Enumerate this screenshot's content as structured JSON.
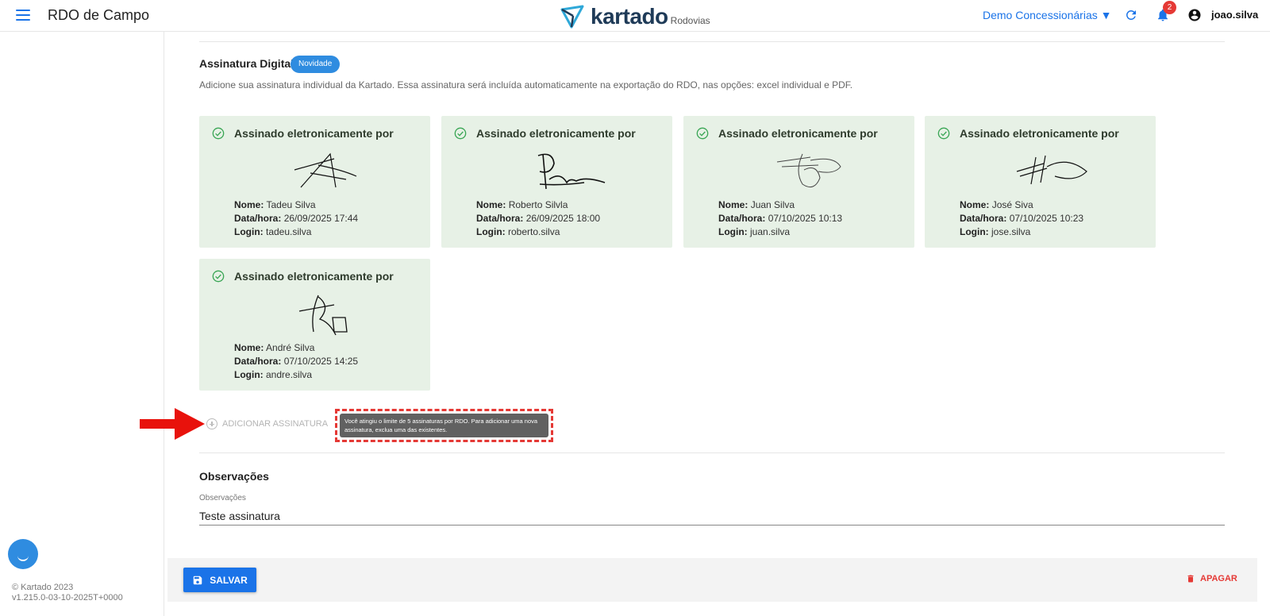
{
  "header": {
    "app_title": "RDO de Campo",
    "logo_word": "kartado",
    "logo_sub": "Rodovias",
    "org_select": "Demo Concessionárias ▼",
    "notification_count": "2",
    "user_name": "joao.silva"
  },
  "sidebar": {
    "copyright_line1": "© Kartado 2023",
    "copyright_line2": "v1.215.0-03-10-2025T+0000"
  },
  "signatures_section": {
    "title": "Assinatura Digital",
    "badge": "Novidade",
    "description": "Adicione sua assinatura individual da Kartado. Essa assinatura será incluída automaticamente na exportação do RDO, nas opções: excel individual e PDF.",
    "card_heading": "Assinado eletronicamente por",
    "label_name": "Nome:",
    "label_datetime": "Data/hora:",
    "label_login": "Login:",
    "cards": [
      {
        "name": "Tadeu Silva",
        "datetime": "26/09/2025 17:44",
        "login": "tadeu.silva"
      },
      {
        "name": "Roberto Silvla",
        "datetime": "26/09/2025 18:00",
        "login": "roberto.silva"
      },
      {
        "name": "Juan Silva",
        "datetime": "07/10/2025 10:13",
        "login": "juan.silva"
      },
      {
        "name": "José Siva",
        "datetime": "07/10/2025 10:23",
        "login": "jose.silva"
      },
      {
        "name": "André Silva",
        "datetime": "07/10/2025 14:25",
        "login": "andre.silva"
      }
    ],
    "add_button": "ADICIONAR ASSINATURA",
    "tooltip": "Você atingiu o limite de 5 assinaturas por RDO. Para adicionar uma nova assinatura, exclua uma das existentes."
  },
  "observations": {
    "title": "Observações",
    "field_label": "Observações",
    "field_value": "Teste assinatura"
  },
  "footer": {
    "save_label": "SALVAR",
    "delete_label": "APAGAR"
  },
  "colors": {
    "primary": "#1a73e8",
    "card_bg": "#e7f1e6",
    "danger": "#e53935"
  }
}
